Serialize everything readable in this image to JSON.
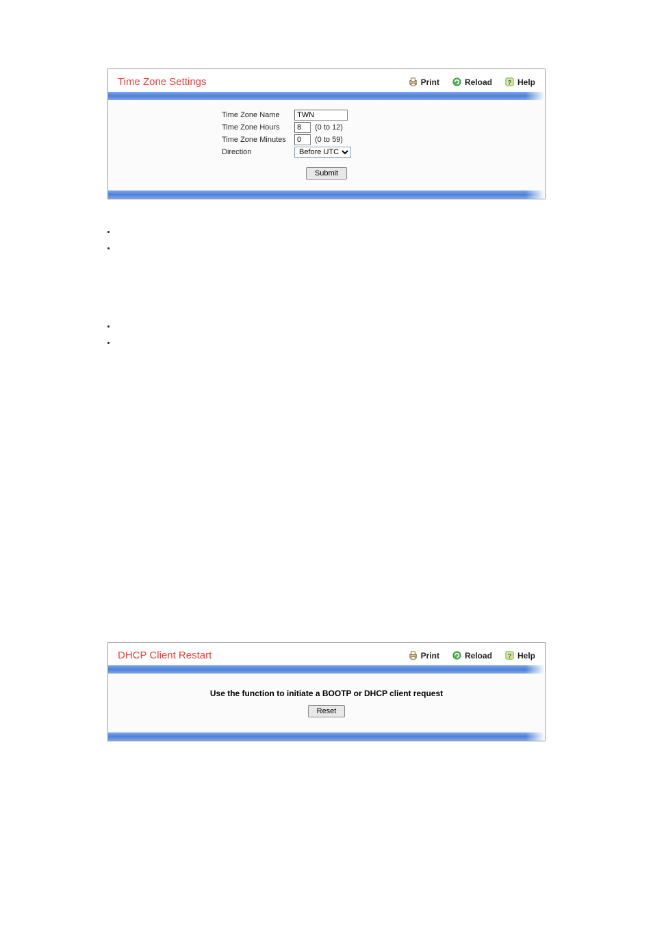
{
  "panel1": {
    "title": "Time Zone Settings",
    "actions": {
      "print": "Print",
      "reload": "Reload",
      "help": "Help"
    },
    "form": {
      "name_label": "Time Zone Name",
      "name_value": "TWN",
      "hours_label": "Time Zone Hours",
      "hours_value": "8",
      "hours_hint": "(0 to 12)",
      "minutes_label": "Time Zone Minutes",
      "minutes_value": "0",
      "minutes_hint": "(0 to 59)",
      "direction_label": "Direction",
      "direction_value": "Before UTC",
      "submit": "Submit"
    }
  },
  "panel2": {
    "title": "DHCP Client Restart",
    "actions": {
      "print": "Print",
      "reload": "Reload",
      "help": "Help"
    },
    "body_text": "Use the function to initiate a BOOTP or DHCP client request",
    "reset": "Reset"
  },
  "icons": {
    "print": "print-icon",
    "reload": "reload-icon",
    "help": "help-icon"
  }
}
